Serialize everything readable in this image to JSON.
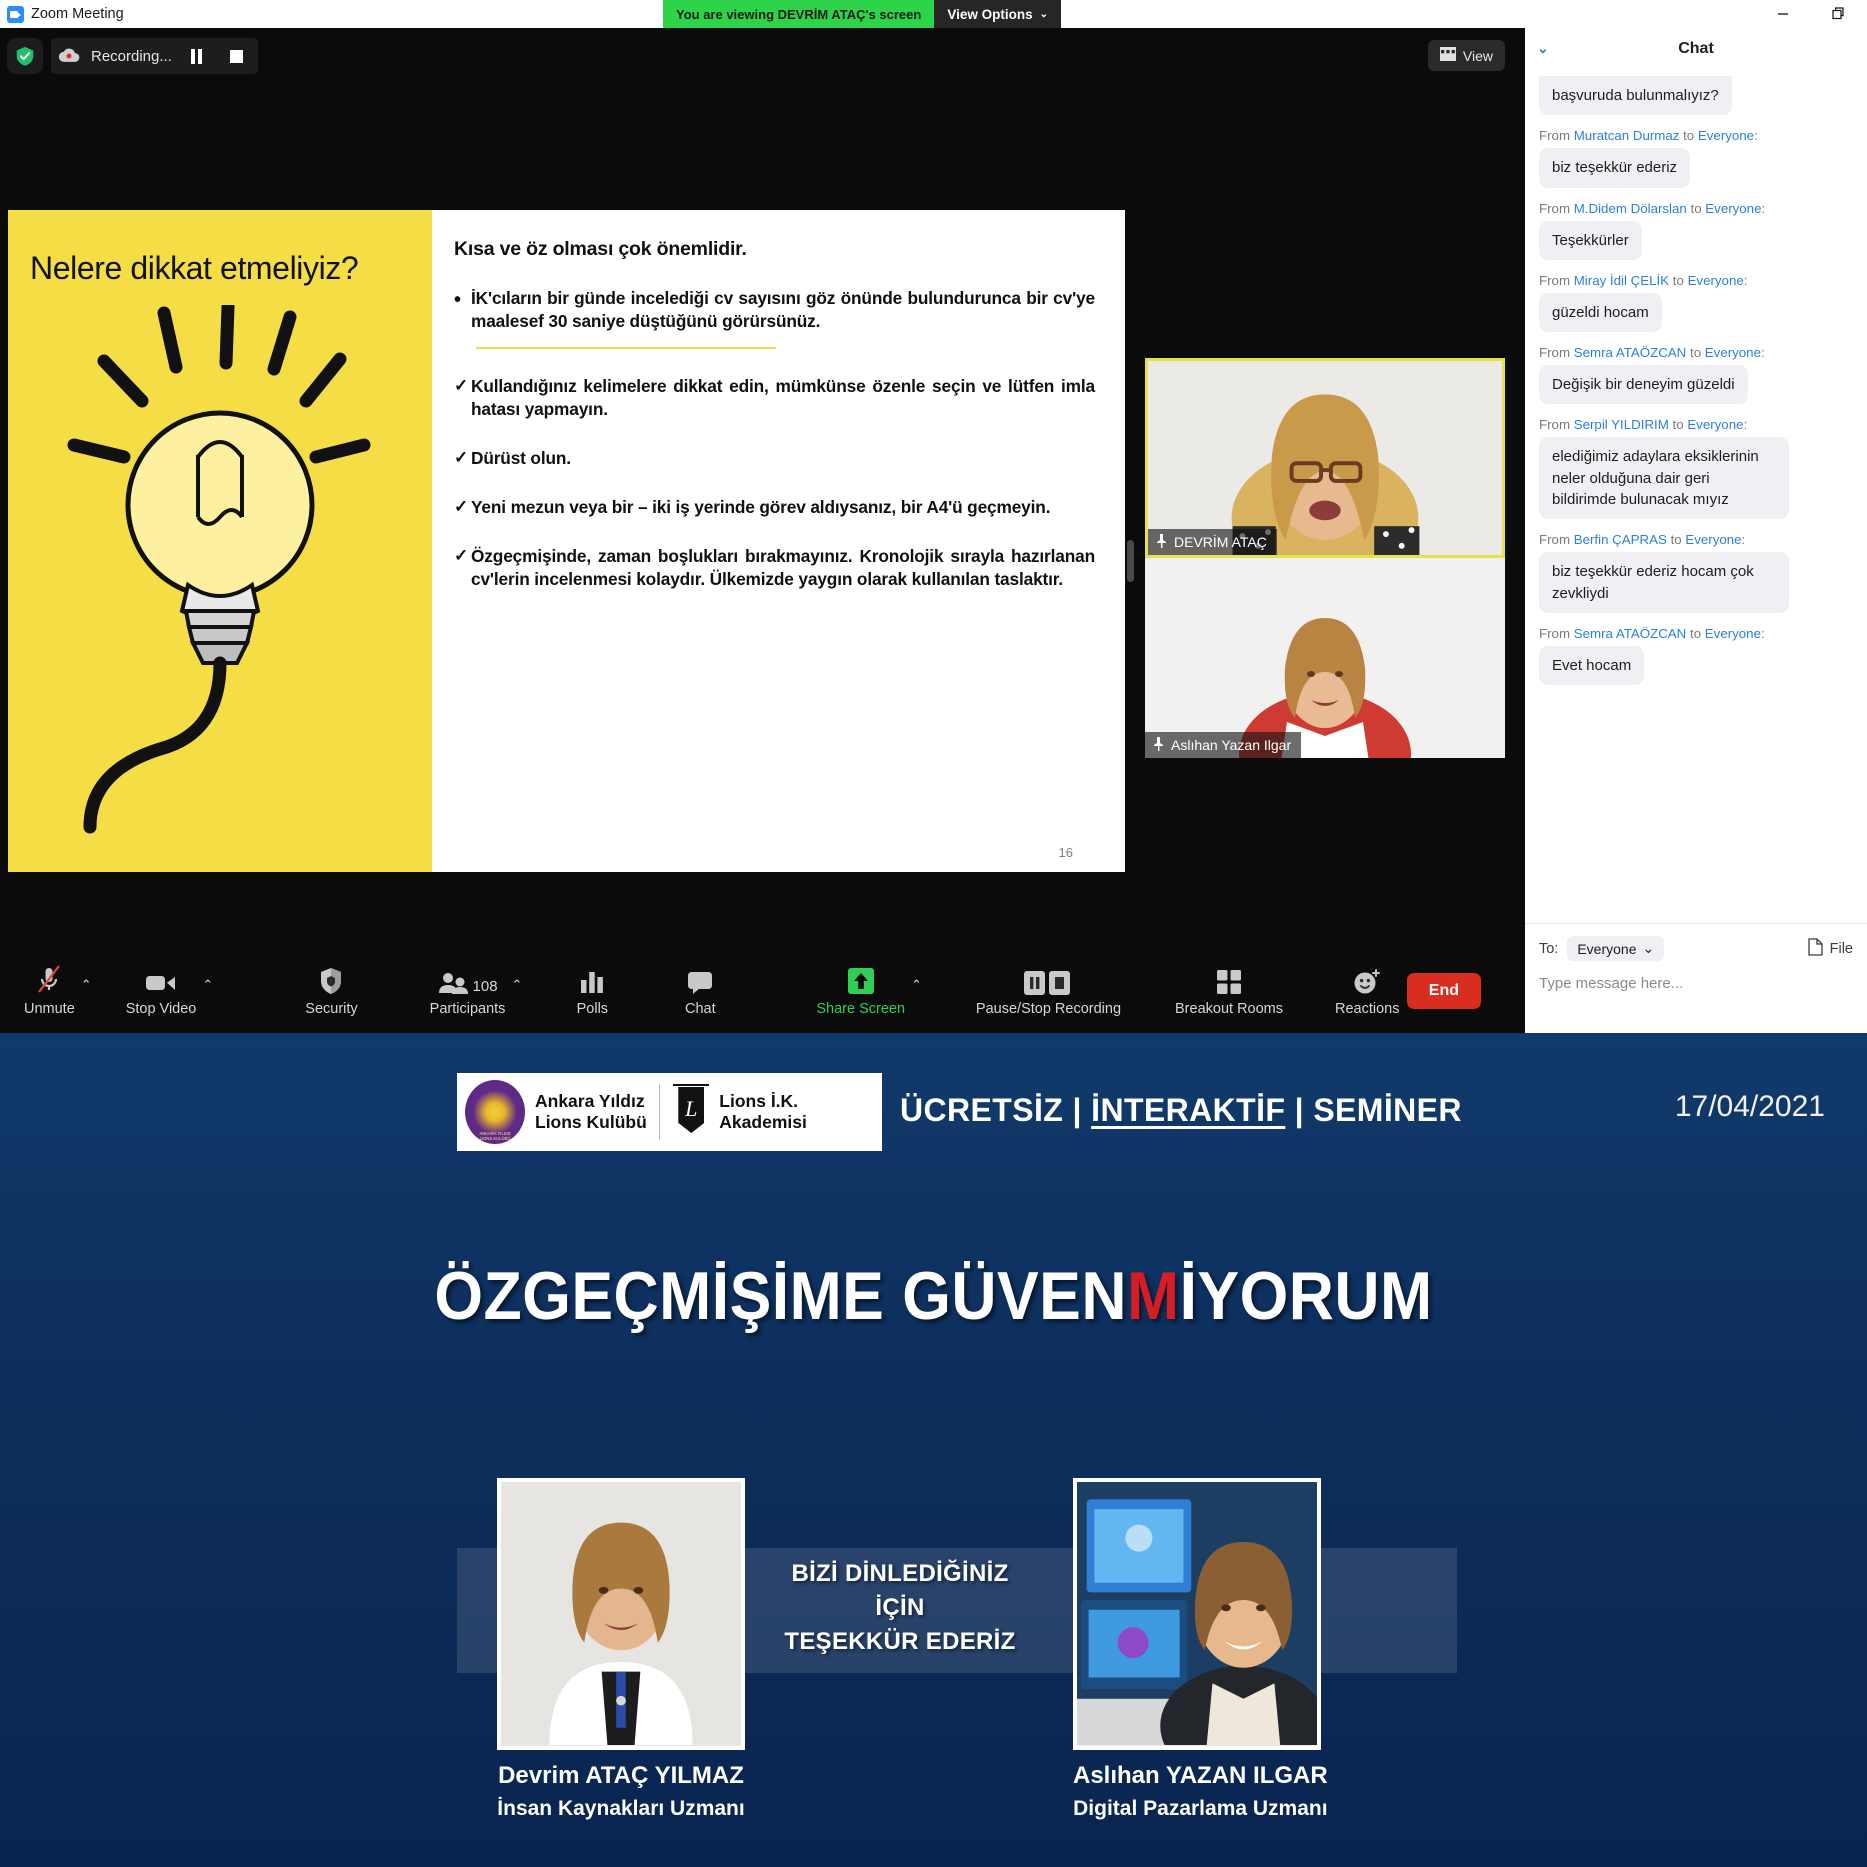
{
  "titlebar": {
    "app_title": "Zoom Meeting",
    "viewing_banner": "You are viewing DEVRİM ATAÇ's screen",
    "view_options": "View Options",
    "view_options_caret": "⌄",
    "minimize": "minimize-icon",
    "restore": "restore-icon"
  },
  "recording": {
    "label": "Recording...",
    "pause": "pause-recording",
    "stop": "stop-recording"
  },
  "view_button": {
    "label": "View"
  },
  "slide": {
    "left_title": "Nelere dikkat etmeliyiz?",
    "heading": "Kısa ve öz olması çok önemlidir.",
    "bullets": [
      {
        "mark": "•",
        "text": "İK'cıların bir günde incelediği cv sayısını göz önünde bulundurunca bir cv'ye maalesef 30 saniye düştüğünü görürsünüz."
      },
      {
        "mark": "✓",
        "text": "Kullandığınız kelimelere dikkat edin, mümkünse özenle seçin ve lütfen imla hatası yapmayın."
      },
      {
        "mark": "✓",
        "text": "Dürüst olun."
      },
      {
        "mark": "✓",
        "text": "Yeni mezun veya bir – iki   iş yerinde görev aldıysanız, bir A4'ü geçmeyin."
      },
      {
        "mark": "✓",
        "text": "Özgeçmişinde, zaman boşlukları bırakmayınız. Kronolojik sırayla hazırlanan cv'lerin incelenmesi kolaydır. Ülkemizde yaygın olarak kullanılan taslaktır."
      }
    ],
    "page_number": "16"
  },
  "thumbnails": [
    {
      "name": "DEVRİM ATAÇ",
      "pinned": true,
      "active": true
    },
    {
      "name": "Aslıhan Yazan Ilgar",
      "pinned": true,
      "active": false
    }
  ],
  "toolbar": {
    "mute": {
      "label": "Unmute",
      "icon": "microphone-muted-icon",
      "caret": "⌃"
    },
    "video": {
      "label": "Stop Video",
      "icon": "camera-icon",
      "caret": "⌃"
    },
    "security": {
      "label": "Security",
      "icon": "shield-icon"
    },
    "participants": {
      "label": "Participants",
      "count": "108",
      "icon": "people-icon",
      "caret": "⌃"
    },
    "polls": {
      "label": "Polls",
      "icon": "bar-chart-icon"
    },
    "chat": {
      "label": "Chat",
      "icon": "speech-bubble-icon"
    },
    "share": {
      "label": "Share Screen",
      "icon": "up-arrow-icon",
      "caret": "⌃"
    },
    "record": {
      "label": "Pause/Stop Recording",
      "icon": "pause-stop-icon"
    },
    "breakout": {
      "label": "Breakout Rooms",
      "icon": "grid-icon"
    },
    "reactions": {
      "label": "Reactions",
      "icon": "smiley-plus-icon"
    },
    "end": {
      "label": "End"
    }
  },
  "chat": {
    "title": "Chat",
    "collapse_caret": "⌄",
    "messages": [
      {
        "from": "",
        "to": "",
        "header": false,
        "text": "başvuruda bulunmalıyız?",
        "clipped": true
      },
      {
        "from": "Muratcan Durmaz",
        "to": "Everyone",
        "header": true,
        "text": "biz teşekkür ederiz"
      },
      {
        "from": "M.Didem Dölarslan",
        "to": "Everyone",
        "header": true,
        "text": "Teşekkürler"
      },
      {
        "from": "Miray İdil ÇELİK",
        "to": "Everyone",
        "header": true,
        "text": "güzeldi hocam"
      },
      {
        "from": "Semra ATAÖZCAN",
        "to": "Everyone",
        "header": true,
        "text": "Değişik bir deneyim güzeldi"
      },
      {
        "from": "Serpil YILDIRIM",
        "to": "Everyone",
        "header": true,
        "text": "elediğimiz adaylara eksiklerinin neler olduğuna dair geri bildirimde bulunacak mıyız"
      },
      {
        "from": "Berfin ÇAPRAS",
        "to": "Everyone",
        "header": true,
        "text": "biz teşekkür ederiz hocam çok zevkliydi"
      },
      {
        "from": "Semra ATAÖZCAN",
        "to": "Everyone",
        "header": true,
        "text": "Evet hocam"
      }
    ],
    "from_prefix": "From",
    "to_prefix": "to",
    "to_label": "To:",
    "to_value": "Everyone",
    "to_caret": "⌄",
    "file_label": "File",
    "input_placeholder": "Type message here..."
  },
  "lower_slide": {
    "org1_line1": "Ankara Yıldız",
    "org1_line2": "Lions Kulübü",
    "badge_caption": "ANKARA YILDIZ\nLIONS KULÜBÜ",
    "pennant_letter": "L",
    "org2_line1": "Lions İ.K.",
    "org2_line2": "Akademisi",
    "seminar_a": "ÜCRETSİZ",
    "seminar_sep1": "|",
    "seminar_b": "İNTERAKTİF",
    "seminar_sep2": "|",
    "seminar_c": "SEMİNER",
    "date": "17/04/2021",
    "title_part1": "ÖZGEÇMİŞİME  GÜVEN",
    "title_red": "M",
    "title_part2": "İYORUM",
    "thanks": "BİZİ DİNLEDİĞİNİZ\nİÇİN\nTEŞEKKÜR EDERİZ",
    "speakers": [
      {
        "name": "Devrim ATAÇ YILMAZ",
        "role": "İnsan Kaynakları Uzmanı"
      },
      {
        "name": "Aslıhan YAZAN ILGAR",
        "role": "Digital Pazarlama Uzmanı"
      }
    ]
  },
  "colors": {
    "zoom_blue": "#2d8cff",
    "share_green": "#2dd44a",
    "end_red": "#d92d20",
    "slide_yellow": "#f5dd45",
    "deep_blue": "#0d2a56",
    "link_blue": "#2a7fe0"
  }
}
